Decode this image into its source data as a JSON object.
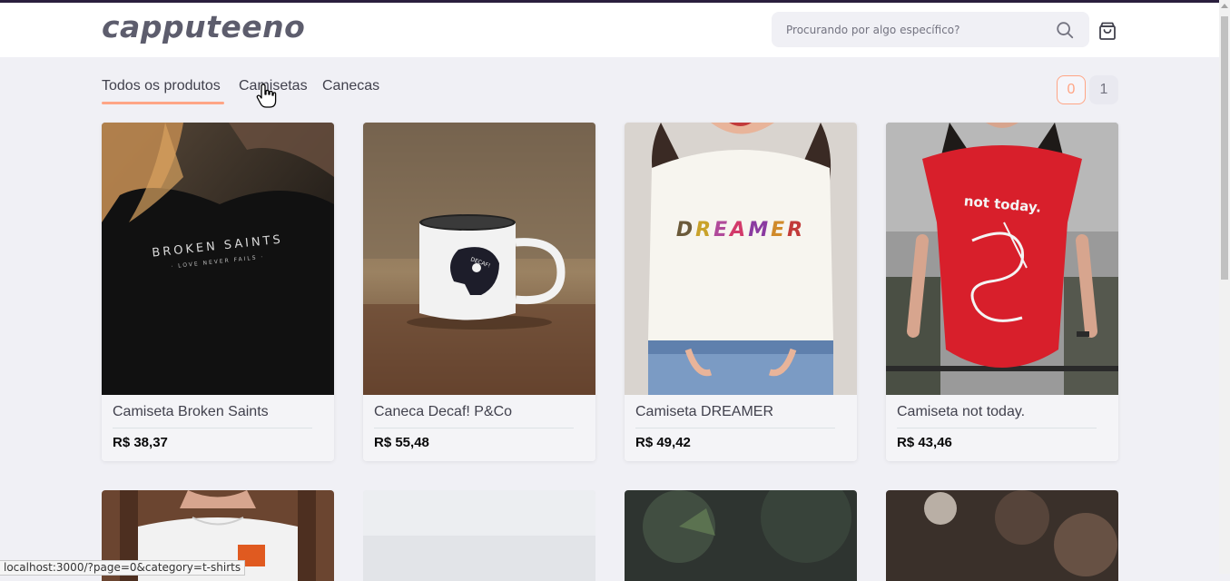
{
  "brand": {
    "logo_text": "capputeeno"
  },
  "search": {
    "placeholder": "Procurando por algo específico?",
    "value": "",
    "icon": "search-icon"
  },
  "cart": {
    "icon": "shopping-bag-icon"
  },
  "filters": {
    "tabs": [
      {
        "label": "Todos os produtos",
        "active": true
      },
      {
        "label": "Camisetas",
        "active": false
      },
      {
        "label": "Canecas",
        "active": false
      }
    ]
  },
  "pagination": {
    "pages": [
      "0",
      "1"
    ],
    "current": "0"
  },
  "products": [
    {
      "name": "Camiseta Broken Saints",
      "price": "R$ 38,37",
      "image": "black t-shirt with BROKEN SAINTS print"
    },
    {
      "name": "Caneca Decaf! P&Co",
      "price": "R$ 55,48",
      "image": "white enamel mug with skull print"
    },
    {
      "name": "Camiseta DREAMER",
      "price": "R$ 49,42",
      "image": "white t-shirt with DREAMER print"
    },
    {
      "name": "Camiseta not today.",
      "price": "R$ 43,46",
      "image": "red t-shirt with not today. print"
    }
  ],
  "status_bar": {
    "url": "localhost:3000/?page=0&category=t-shirts"
  },
  "colors": {
    "accent": "#ffa585",
    "text": "#41414d",
    "background": "#f0f0f5",
    "header_bar": "#2a1f3d",
    "logo": "#5d5d6d"
  }
}
